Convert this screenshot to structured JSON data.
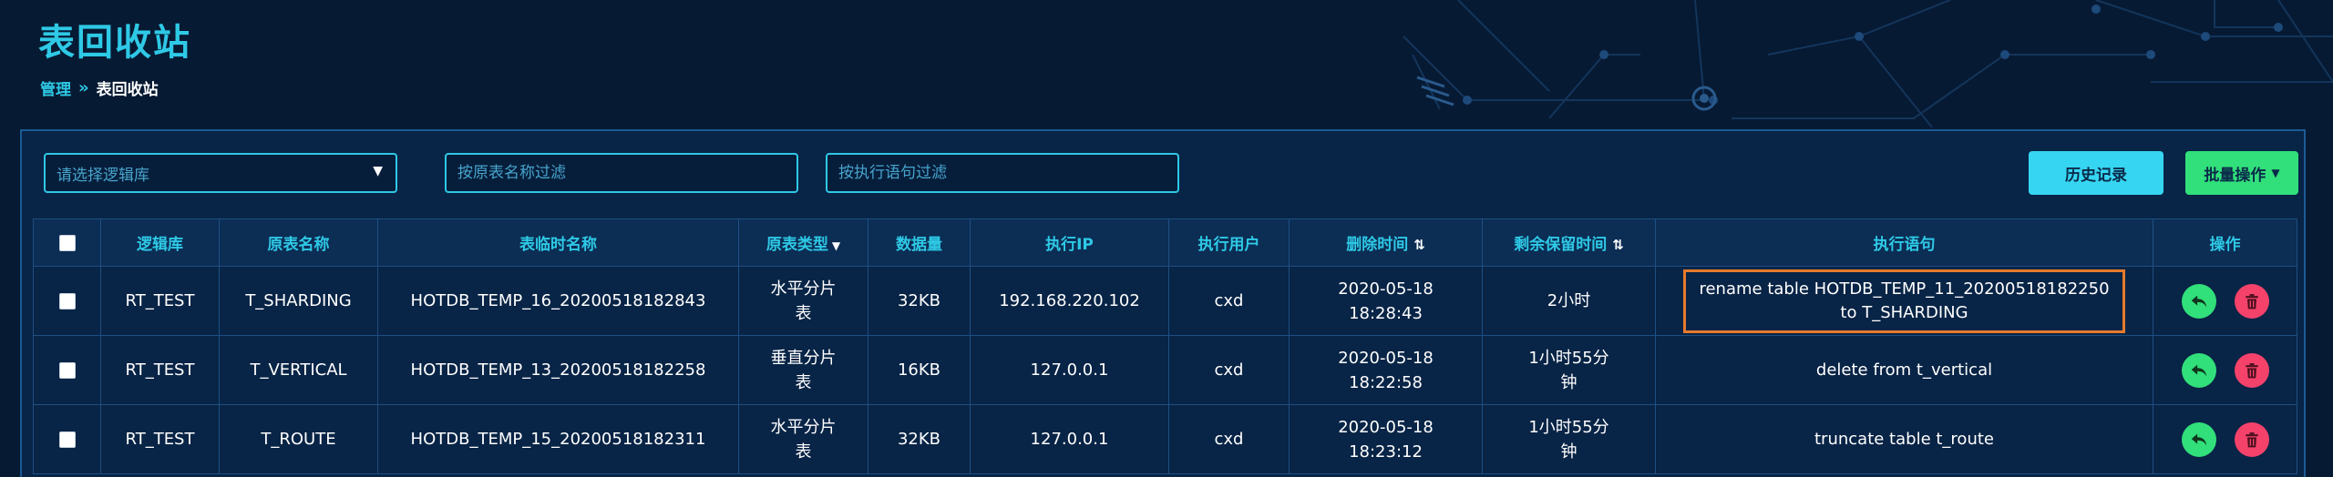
{
  "page": {
    "title": "表回收站",
    "breadcrumb": {
      "root": "管理",
      "sep": "»",
      "current": "表回收站"
    }
  },
  "filters": {
    "db_placeholder": "请选择逻辑库",
    "table_placeholder": "按原表名称过滤",
    "stmt_placeholder": "按执行语句过滤"
  },
  "toolbar": {
    "history_label": "历史记录",
    "batch_label": "批量操作"
  },
  "table": {
    "headers": [
      "逻辑库",
      "原表名称",
      "表临时名称",
      "原表类型",
      "数据量",
      "执行IP",
      "执行用户",
      "删除时间",
      "剩余保留时间",
      "执行语句",
      "操作"
    ],
    "rows": [
      {
        "db": "RT_TEST",
        "orig_name": "T_SHARDING",
        "temp_name": "HOTDB_TEMP_16_20200518182843",
        "type_line1": "水平分片",
        "type_line2": "表",
        "size": "32KB",
        "ip": "192.168.220.102",
        "user": "cxd",
        "del_date": "2020-05-18",
        "del_time": "18:28:43",
        "remain_line1": "2小时",
        "remain_line2": "",
        "stmt_line1": "rename table HOTDB_TEMP_11_20200518182250",
        "stmt_line2": "to T_SHARDING",
        "highlighted": true
      },
      {
        "db": "RT_TEST",
        "orig_name": "T_VERTICAL",
        "temp_name": "HOTDB_TEMP_13_20200518182258",
        "type_line1": "垂直分片",
        "type_line2": "表",
        "size": "16KB",
        "ip": "127.0.0.1",
        "user": "cxd",
        "del_date": "2020-05-18",
        "del_time": "18:22:58",
        "remain_line1": "1小时55分",
        "remain_line2": "钟",
        "stmt_line1": "delete from t_vertical",
        "stmt_line2": "",
        "highlighted": false
      },
      {
        "db": "RT_TEST",
        "orig_name": "T_ROUTE",
        "temp_name": "HOTDB_TEMP_15_20200518182311",
        "type_line1": "水平分片",
        "type_line2": "表",
        "size": "32KB",
        "ip": "127.0.0.1",
        "user": "cxd",
        "del_date": "2020-05-18",
        "del_time": "18:23:12",
        "remain_line1": "1小时55分",
        "remain_line2": "钟",
        "stmt_line1": "truncate table t_route",
        "stmt_line2": "",
        "highlighted": false
      }
    ]
  },
  "icons": {
    "restore": "undo-arrow-icon",
    "delete": "trash-icon",
    "sort": "sort-arrows-icon",
    "dropdown": "caret-down-icon"
  },
  "colors": {
    "accent": "#2ec9e6",
    "history_button": "#36d6f2",
    "batch_button": "#31e07a",
    "restore": "#31e07a",
    "delete": "#f4426b",
    "highlight_border": "#e67a2b"
  }
}
